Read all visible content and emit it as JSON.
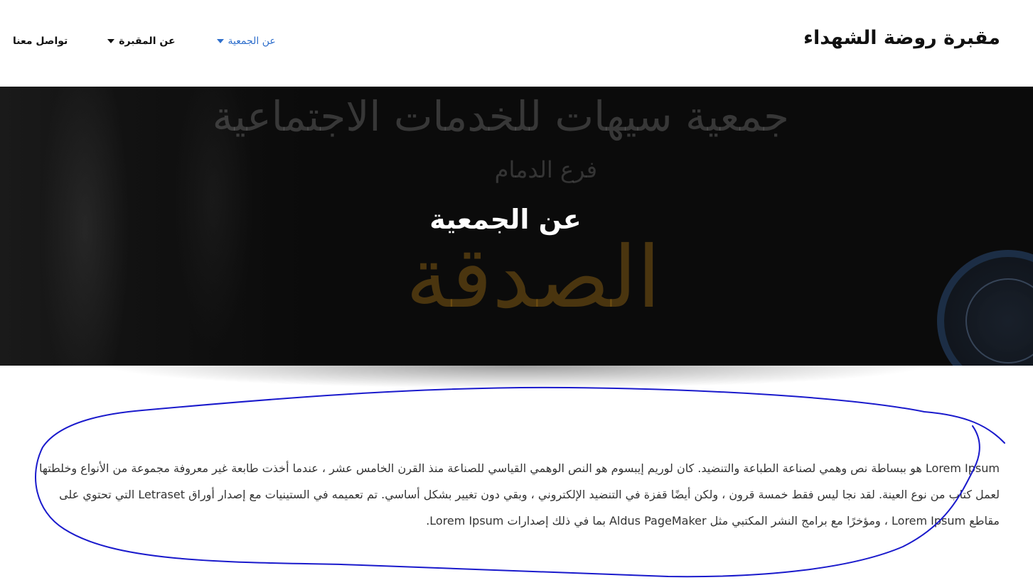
{
  "header": {
    "site_title": "مقبرة روضة الشهداء",
    "nav": [
      {
        "label": "تواصل معنا",
        "has_dropdown": false,
        "active": false
      },
      {
        "label": "عن المقبرة",
        "has_dropdown": true,
        "active": false
      },
      {
        "label": "عن الجمعية",
        "has_dropdown": true,
        "active": true
      }
    ]
  },
  "hero": {
    "title": "عن الجمعية",
    "calligraphy_top": "جمعية سيهات للخدمات الاجتماعية",
    "calligraphy_sub": "فرع الدمام",
    "calligraphy_gold": "الصدقة"
  },
  "content": {
    "paragraph": "Lorem Ipsum هو ببساطة نص وهمي لصناعة الطباعة والتنضيد. كان لوريم إيبسوم هو النص الوهمي القياسي للصناعة منذ القرن الخامس عشر ، عندما أخذت طابعة غير معروفة مجموعة من الأنواع وخلطتها لعمل كتاب من نوع العينة. لقد نجا ليس فقط خمسة قرون ، ولكن أيضًا قفزة في التنضيد الإلكتروني ، وبقي دون تغيير بشكل أساسي. تم تعميمه في الستينيات مع إصدار أوراق Letraset التي تحتوي على مقاطع Lorem Ipsum ، ومؤخرًا مع برامج النشر المكتبي مثل Aldus PageMaker بما في ذلك إصدارات Lorem Ipsum."
  },
  "colors": {
    "active_nav": "#2f6fcc",
    "text": "#333333",
    "annotation": "#1a1acc"
  }
}
